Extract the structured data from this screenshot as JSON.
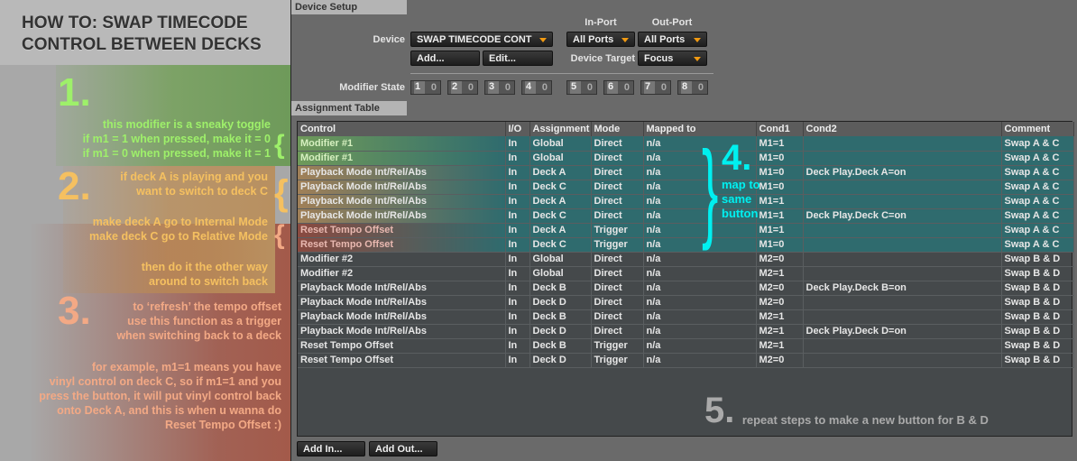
{
  "tutorial": {
    "title_line1": "HOW TO: SWAP TIMECODE",
    "title_line2": "CONTROL BETWEEN DECKS",
    "step1": {
      "num": "1.",
      "lines": [
        "this modifier is a sneaky toggle",
        "if m1 = 1 when pressed, make it = 0",
        "if m1 = 0 when pressed, make it = 1"
      ]
    },
    "step2": {
      "num": "2.",
      "lines": [
        "if deck A is playing and you",
        "want to switch to deck C"
      ],
      "lines2": [
        "make deck A go to Internal Mode",
        "make deck C go to Relative Mode"
      ],
      "lines3": [
        "then do it the other way",
        "around to switch back"
      ]
    },
    "step3": {
      "num": "3.",
      "lines": [
        "to ‘refresh’ the tempo offset",
        "use this function as a trigger",
        "when switching back to a deck"
      ],
      "lines2": [
        "for example, m1=1 means you have",
        "vinyl control on deck C, so if m1=1 and you",
        "press the button, it will put vinyl control back",
        "onto Deck A, and this is when u wanna do",
        "Reset Tempo Offset :)"
      ]
    },
    "step4": {
      "num": "4.",
      "lines": [
        "map to",
        "same",
        "button"
      ]
    },
    "step5": {
      "num": "5.",
      "text": "repeat steps to make a new button for B & D"
    },
    "colors": {
      "green": "#9ef06a",
      "orange": "#f5c060",
      "red": "#f3a985",
      "cyan": "#00f0f0"
    }
  },
  "device_setup": {
    "section": "Device Setup",
    "device_label": "Device",
    "device_value": "SWAP TIMECODE CONT",
    "add": "Add...",
    "edit": "Edit...",
    "in_port_label": "In-Port",
    "in_port_value": "All Ports",
    "out_port_label": "Out-Port",
    "out_port_value": "All Ports",
    "device_target_label": "Device Target",
    "device_target_value": "Focus",
    "modifier_state_label": "Modifier State",
    "modifiers": [
      [
        "1",
        "0"
      ],
      [
        "2",
        "0"
      ],
      [
        "3",
        "0"
      ],
      [
        "4",
        "0"
      ],
      [
        "5",
        "0"
      ],
      [
        "6",
        "0"
      ],
      [
        "7",
        "0"
      ],
      [
        "8",
        "0"
      ]
    ]
  },
  "assignment_table": {
    "section": "Assignment Table",
    "columns": [
      "Control",
      "I/O",
      "Assignment",
      "Mode",
      "Mapped to",
      "Cond1",
      "Cond2",
      "Comment"
    ],
    "rows": [
      [
        "Modifier #1",
        "In",
        "Global",
        "Direct",
        "n/a",
        "M1=1",
        "",
        "Swap A & C"
      ],
      [
        "Modifier #1",
        "In",
        "Global",
        "Direct",
        "n/a",
        "M1=0",
        "",
        "Swap A & C"
      ],
      [
        "Playback Mode Int/Rel/Abs",
        "In",
        "Deck A",
        "Direct",
        "n/a",
        "M1=0",
        "Deck Play.Deck A=on",
        "Swap A & C"
      ],
      [
        "Playback Mode Int/Rel/Abs",
        "In",
        "Deck C",
        "Direct",
        "n/a",
        "M1=0",
        "",
        "Swap A & C"
      ],
      [
        "Playback Mode Int/Rel/Abs",
        "In",
        "Deck A",
        "Direct",
        "n/a",
        "M1=1",
        "",
        "Swap A & C"
      ],
      [
        "Playback Mode Int/Rel/Abs",
        "In",
        "Deck C",
        "Direct",
        "n/a",
        "M1=1",
        "Deck Play.Deck C=on",
        "Swap A & C"
      ],
      [
        "Reset Tempo Offset",
        "In",
        "Deck A",
        "Trigger",
        "n/a",
        "M1=1",
        "",
        "Swap A & C"
      ],
      [
        "Reset Tempo Offset",
        "In",
        "Deck C",
        "Trigger",
        "n/a",
        "M1=0",
        "",
        "Swap A & C"
      ],
      [
        "Modifier #2",
        "In",
        "Global",
        "Direct",
        "n/a",
        "M2=0",
        "",
        "Swap B & D"
      ],
      [
        "Modifier #2",
        "In",
        "Global",
        "Direct",
        "n/a",
        "M2=1",
        "",
        "Swap B & D"
      ],
      [
        "Playback Mode Int/Rel/Abs",
        "In",
        "Deck B",
        "Direct",
        "n/a",
        "M2=0",
        "Deck Play.Deck B=on",
        "Swap B & D"
      ],
      [
        "Playback Mode Int/Rel/Abs",
        "In",
        "Deck D",
        "Direct",
        "n/a",
        "M2=0",
        "",
        "Swap B & D"
      ],
      [
        "Playback Mode Int/Rel/Abs",
        "In",
        "Deck B",
        "Direct",
        "n/a",
        "M2=1",
        "",
        "Swap B & D"
      ],
      [
        "Playback Mode Int/Rel/Abs",
        "In",
        "Deck D",
        "Direct",
        "n/a",
        "M2=1",
        "Deck Play.Deck D=on",
        "Swap B & D"
      ],
      [
        "Reset Tempo Offset",
        "In",
        "Deck B",
        "Trigger",
        "n/a",
        "M2=1",
        "",
        "Swap B & D"
      ],
      [
        "Reset Tempo Offset",
        "In",
        "Deck D",
        "Trigger",
        "n/a",
        "M2=0",
        "",
        "Swap B & D"
      ]
    ],
    "add_in": "Add In...",
    "add_out": "Add Out..."
  }
}
